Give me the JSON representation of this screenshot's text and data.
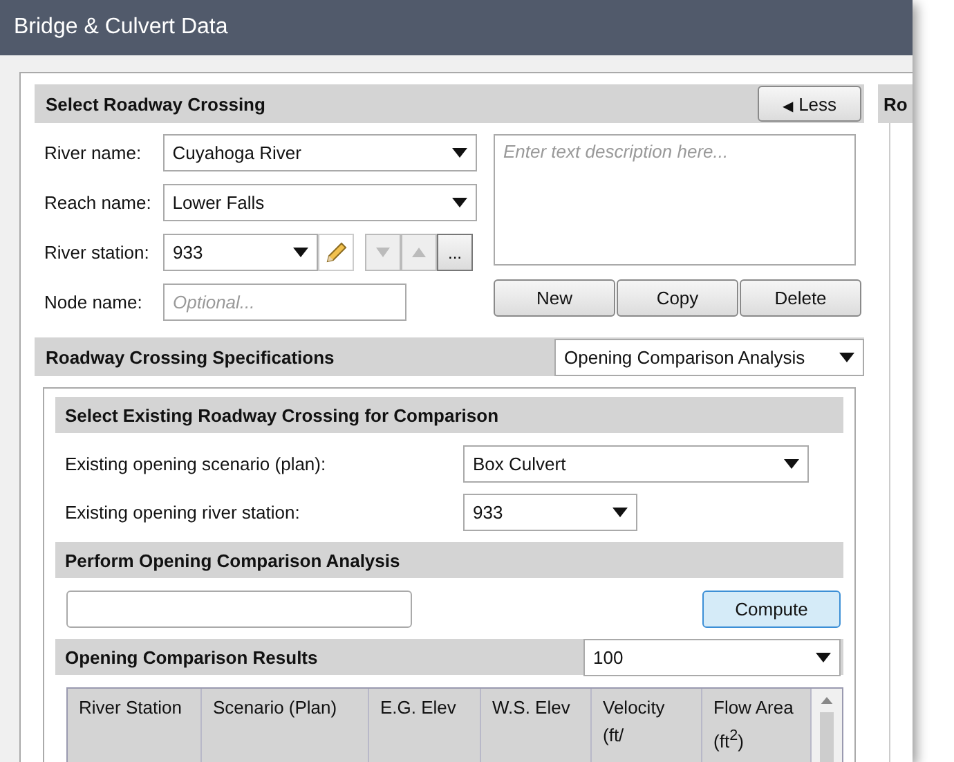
{
  "window": {
    "title": "Bridge & Culvert Data"
  },
  "select_roadway_crossing": {
    "title": "Select Roadway Crossing",
    "less_button": {
      "arrow": "◀",
      "label": "Less"
    },
    "fields": [
      {
        "label": "River name:",
        "value": "Cuyahoga River",
        "kind": "combo"
      },
      {
        "label": "Reach name:",
        "value": "Lower Falls",
        "kind": "combo"
      },
      {
        "label": "River station:",
        "value": "933",
        "kind": "station"
      },
      {
        "label": "Node name:",
        "placeholder": "Optional...",
        "kind": "text"
      }
    ],
    "browse_button": "...",
    "description": {
      "placeholder": "Enter text description here..."
    },
    "buttons": [
      "New",
      "Copy",
      "Delete"
    ]
  },
  "side_panel": {
    "title": "Ro"
  },
  "roadway_crossing_specifications": {
    "title": "Roadway Crossing Specifications",
    "mode": "Opening Comparison Analysis",
    "existing": {
      "title": "Select Existing Roadway Crossing for Comparison",
      "rows": [
        {
          "label": "Existing opening scenario (plan):",
          "value": "Box Culvert",
          "kind": "wide"
        },
        {
          "label": "Existing opening river station:",
          "value": "933",
          "kind": "narrow"
        }
      ]
    },
    "perform": {
      "title": "Perform Opening Comparison Analysis",
      "button": "Compute"
    },
    "results": {
      "title": "Opening Comparison Results",
      "profile": "100",
      "columns": [
        "River Station",
        "Scenario (Plan)",
        "E.G. Elev",
        "W.S. Elev",
        "Velocity (ft/",
        "Flow Area (ft$^{2}$)"
      ]
    }
  }
}
